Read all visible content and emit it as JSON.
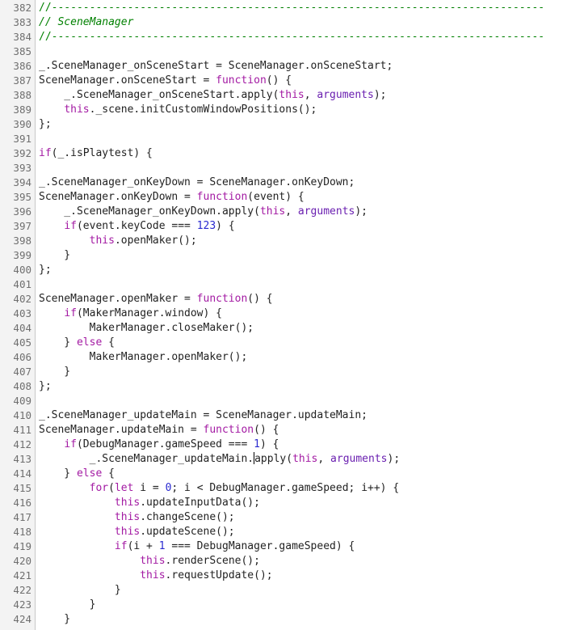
{
  "editor": {
    "colors": {
      "comment": "#008000",
      "keyword": "#a31aa3",
      "builtin": "#6a1fb0",
      "number": "#2a2ad0",
      "text": "#222222",
      "gutter_bg": "#f3f3f3",
      "line_number": "#6f6f6f"
    },
    "lines": [
      {
        "n": "382",
        "tokens": [
          {
            "t": "//------------------------------------------------------------------------------",
            "c": "comment"
          }
        ]
      },
      {
        "n": "383",
        "tokens": [
          {
            "t": "// SceneManager",
            "c": "comment-italic"
          }
        ]
      },
      {
        "n": "384",
        "tokens": [
          {
            "t": "//------------------------------------------------------------------------------",
            "c": "comment"
          }
        ]
      },
      {
        "n": "385",
        "tokens": []
      },
      {
        "n": "386",
        "tokens": [
          {
            "t": "_.SceneManager_onSceneStart = SceneManager.onSceneStart;"
          }
        ]
      },
      {
        "n": "387",
        "tokens": [
          {
            "t": "SceneManager.onSceneStart = "
          },
          {
            "t": "function",
            "c": "kw"
          },
          {
            "t": "() {"
          }
        ]
      },
      {
        "n": "388",
        "tokens": [
          {
            "t": "    _.SceneManager_onSceneStart.apply("
          },
          {
            "t": "this",
            "c": "kw"
          },
          {
            "t": ", "
          },
          {
            "t": "arguments",
            "c": "builtin"
          },
          {
            "t": ");"
          }
        ]
      },
      {
        "n": "389",
        "tokens": [
          {
            "t": "    "
          },
          {
            "t": "this",
            "c": "kw"
          },
          {
            "t": "._scene.initCustomWindowPositions();"
          }
        ]
      },
      {
        "n": "390",
        "tokens": [
          {
            "t": "};"
          }
        ]
      },
      {
        "n": "391",
        "tokens": []
      },
      {
        "n": "392",
        "tokens": [
          {
            "t": "if",
            "c": "kw"
          },
          {
            "t": "(_.isPlaytest) {"
          }
        ]
      },
      {
        "n": "393",
        "tokens": []
      },
      {
        "n": "394",
        "tokens": [
          {
            "t": "_.SceneManager_onKeyDown = SceneManager.onKeyDown;"
          }
        ]
      },
      {
        "n": "395",
        "tokens": [
          {
            "t": "SceneManager.onKeyDown = "
          },
          {
            "t": "function",
            "c": "kw"
          },
          {
            "t": "(event) {"
          }
        ]
      },
      {
        "n": "396",
        "tokens": [
          {
            "t": "    _.SceneManager_onKeyDown.apply("
          },
          {
            "t": "this",
            "c": "kw"
          },
          {
            "t": ", "
          },
          {
            "t": "arguments",
            "c": "builtin"
          },
          {
            "t": ");"
          }
        ]
      },
      {
        "n": "397",
        "tokens": [
          {
            "t": "    "
          },
          {
            "t": "if",
            "c": "kw"
          },
          {
            "t": "(event.keyCode === "
          },
          {
            "t": "123",
            "c": "num"
          },
          {
            "t": ") {"
          }
        ]
      },
      {
        "n": "398",
        "tokens": [
          {
            "t": "        "
          },
          {
            "t": "this",
            "c": "kw"
          },
          {
            "t": ".openMaker();"
          }
        ]
      },
      {
        "n": "399",
        "tokens": [
          {
            "t": "    }"
          }
        ]
      },
      {
        "n": "400",
        "tokens": [
          {
            "t": "};"
          }
        ]
      },
      {
        "n": "401",
        "tokens": []
      },
      {
        "n": "402",
        "tokens": [
          {
            "t": "SceneManager.openMaker = "
          },
          {
            "t": "function",
            "c": "kw"
          },
          {
            "t": "() {"
          }
        ]
      },
      {
        "n": "403",
        "tokens": [
          {
            "t": "    "
          },
          {
            "t": "if",
            "c": "kw"
          },
          {
            "t": "(MakerManager.window) {"
          }
        ]
      },
      {
        "n": "404",
        "tokens": [
          {
            "t": "        MakerManager.closeMaker();"
          }
        ]
      },
      {
        "n": "405",
        "tokens": [
          {
            "t": "    } "
          },
          {
            "t": "else",
            "c": "kw"
          },
          {
            "t": " {"
          }
        ]
      },
      {
        "n": "406",
        "tokens": [
          {
            "t": "        MakerManager.openMaker();"
          }
        ]
      },
      {
        "n": "407",
        "tokens": [
          {
            "t": "    }"
          }
        ]
      },
      {
        "n": "408",
        "tokens": [
          {
            "t": "};"
          }
        ]
      },
      {
        "n": "409",
        "tokens": []
      },
      {
        "n": "410",
        "tokens": [
          {
            "t": "_.SceneManager_updateMain = SceneManager.updateMain;"
          }
        ]
      },
      {
        "n": "411",
        "tokens": [
          {
            "t": "SceneManager.updateMain = "
          },
          {
            "t": "function",
            "c": "kw"
          },
          {
            "t": "() {"
          }
        ]
      },
      {
        "n": "412",
        "tokens": [
          {
            "t": "    "
          },
          {
            "t": "if",
            "c": "kw"
          },
          {
            "t": "(DebugManager.gameSpeed === "
          },
          {
            "t": "1",
            "c": "num"
          },
          {
            "t": ") {"
          }
        ]
      },
      {
        "n": "413",
        "tokens": [
          {
            "t": "        _.SceneManager_updateMain."
          },
          {
            "caret": true
          },
          {
            "t": "apply("
          },
          {
            "t": "this",
            "c": "kw"
          },
          {
            "t": ", "
          },
          {
            "t": "arguments",
            "c": "builtin"
          },
          {
            "t": ");"
          }
        ]
      },
      {
        "n": "414",
        "tokens": [
          {
            "t": "    } "
          },
          {
            "t": "else",
            "c": "kw"
          },
          {
            "t": " {"
          }
        ]
      },
      {
        "n": "415",
        "tokens": [
          {
            "t": "        "
          },
          {
            "t": "for",
            "c": "kw"
          },
          {
            "t": "("
          },
          {
            "t": "let",
            "c": "kw"
          },
          {
            "t": " i = "
          },
          {
            "t": "0",
            "c": "num"
          },
          {
            "t": "; i < DebugManager.gameSpeed; i++) {"
          }
        ]
      },
      {
        "n": "416",
        "tokens": [
          {
            "t": "            "
          },
          {
            "t": "this",
            "c": "kw"
          },
          {
            "t": ".updateInputData();"
          }
        ]
      },
      {
        "n": "417",
        "tokens": [
          {
            "t": "            "
          },
          {
            "t": "this",
            "c": "kw"
          },
          {
            "t": ".changeScene();"
          }
        ]
      },
      {
        "n": "418",
        "tokens": [
          {
            "t": "            "
          },
          {
            "t": "this",
            "c": "kw"
          },
          {
            "t": ".updateScene();"
          }
        ]
      },
      {
        "n": "419",
        "tokens": [
          {
            "t": "            "
          },
          {
            "t": "if",
            "c": "kw"
          },
          {
            "t": "(i + "
          },
          {
            "t": "1",
            "c": "num"
          },
          {
            "t": " === DebugManager.gameSpeed) {"
          }
        ]
      },
      {
        "n": "420",
        "tokens": [
          {
            "t": "                "
          },
          {
            "t": "this",
            "c": "kw"
          },
          {
            "t": ".renderScene();"
          }
        ]
      },
      {
        "n": "421",
        "tokens": [
          {
            "t": "                "
          },
          {
            "t": "this",
            "c": "kw"
          },
          {
            "t": ".requestUpdate();"
          }
        ]
      },
      {
        "n": "422",
        "tokens": [
          {
            "t": "            }"
          }
        ]
      },
      {
        "n": "423",
        "tokens": [
          {
            "t": "        }"
          }
        ]
      },
      {
        "n": "424",
        "tokens": [
          {
            "t": "    }"
          }
        ]
      }
    ]
  }
}
